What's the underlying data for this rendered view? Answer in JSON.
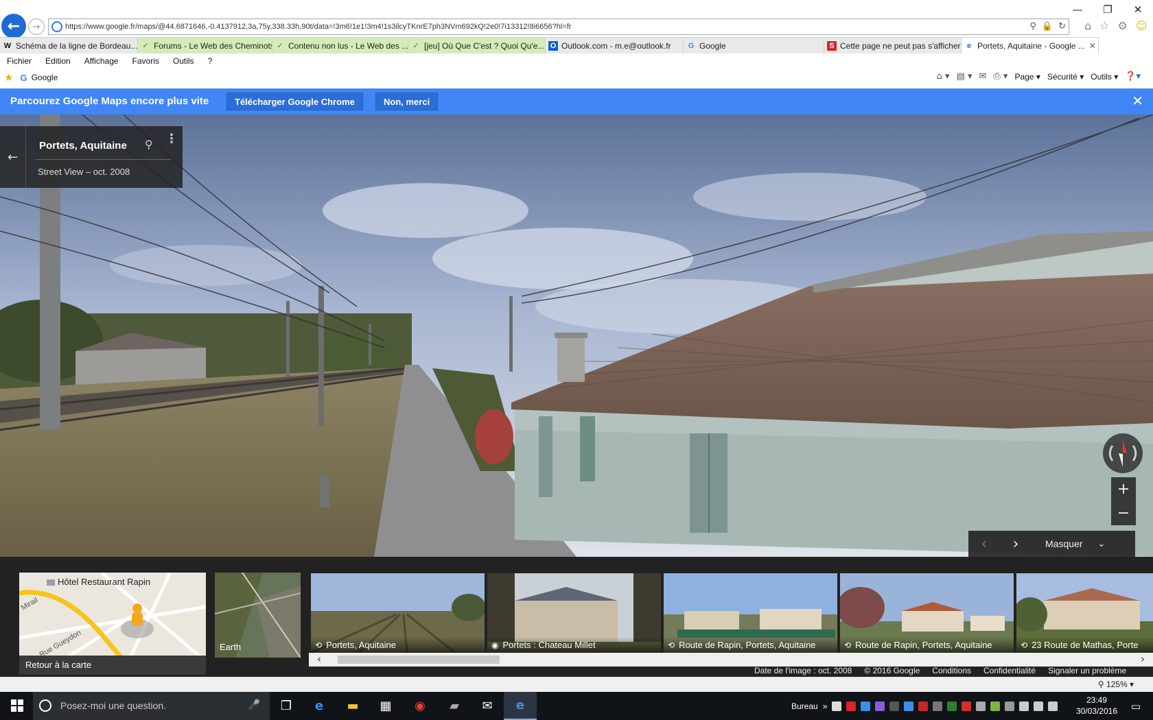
{
  "browser": {
    "url": "https://www.google.fr/maps/@44.6871646,-0.4137912,3a,75y,338.33h,90t/data=!3m6!1e1!3m4!1s3ilcyTKnrE7ph3NVm692kQ!2e0!7i13312!8i6656?hl=fr",
    "tabs": [
      {
        "label": "Schéma de la ligne de Bordeau...",
        "icon": "W"
      },
      {
        "label": "Forums - Le Web des Cheminots",
        "icon": "✓"
      },
      {
        "label": "Contenu non lus - Le Web des ...",
        "icon": "✓"
      },
      {
        "label": "[jeu] Où Que C'est ? Quoi Qu'e...",
        "icon": "✓"
      },
      {
        "label": "Outlook.com - m.e@outlook.fr",
        "icon": "O"
      },
      {
        "label": "Google",
        "icon": "G"
      },
      {
        "label": "Cette page ne peut pas s'afficher",
        "icon": "S"
      },
      {
        "label": "Portets, Aquitaine - Google ...",
        "icon": "e"
      }
    ],
    "menu": [
      "Fichier",
      "Edition",
      "Affichage",
      "Favoris",
      "Outils",
      "?"
    ],
    "favorites": {
      "item": "Google"
    },
    "command_bar": {
      "page": "Page",
      "security": "Sécurité",
      "tools": "Outils"
    },
    "zoom": "125%"
  },
  "banner": {
    "text": "Parcourez Google Maps encore plus vite",
    "download_label": "Télécharger Google Chrome",
    "decline_label": "Non, merci",
    "accent": "#4285f4"
  },
  "infocard": {
    "title": "Portets, Aquitaine",
    "subtitle": "Street View – oct. 2008"
  },
  "navpanel": {
    "hide_label": "Masquer"
  },
  "minimap": {
    "poi": "Hôtel Restaurant Rapin",
    "street1": "Mirail",
    "street2": "Rue Gueydon",
    "back_label": "Retour à la carte"
  },
  "earth": {
    "label": "Earth"
  },
  "thumbnails": [
    {
      "caption": "Portets, Aquitaine",
      "icon": "360-icon"
    },
    {
      "caption": "Portets : Chateau Millet",
      "icon": "camera-icon"
    },
    {
      "caption": "Route de Rapin, Portets, Aquitaine",
      "icon": "360-icon"
    },
    {
      "caption": "Route de Rapin, Portets, Aquitaine",
      "icon": "360-icon"
    },
    {
      "caption": "23 Route de Mathas, Porte",
      "icon": "360-icon"
    }
  ],
  "legal": {
    "date": "Date de l'image : oct. 2008",
    "copyright": "© 2016 Google",
    "terms": "Conditions",
    "privacy": "Confidentialité",
    "report": "Signaler un problème"
  },
  "taskbar": {
    "search_placeholder": "Posez-moi une question.",
    "desktop_label": "Bureau",
    "time": "23:49",
    "date": "30/03/2016"
  }
}
